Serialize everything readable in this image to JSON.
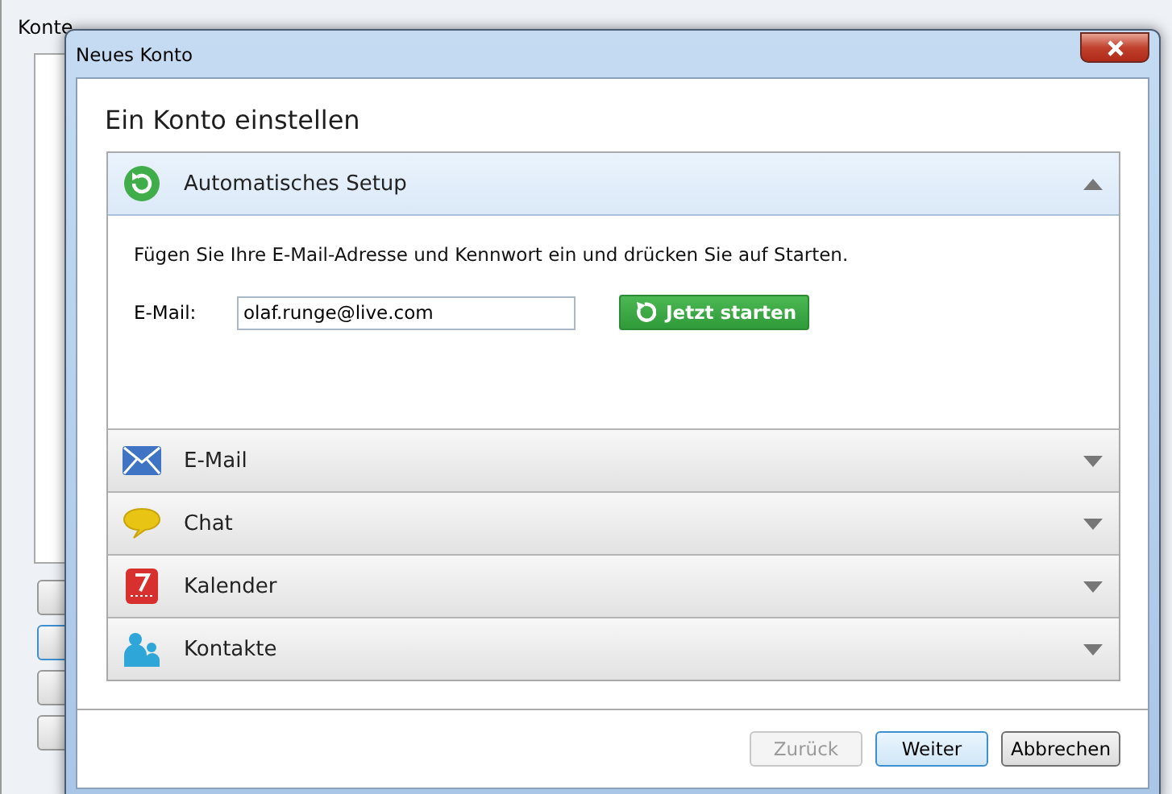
{
  "background_window": {
    "title": "Konte"
  },
  "dialog": {
    "title": "Neues Konto",
    "heading": "Ein Konto einstellen",
    "sections": [
      {
        "kind": "auto",
        "label": "Automatisches Setup",
        "expanded": true,
        "instruction": "Fügen Sie Ihre E-Mail-Adresse und Kennwort ein und drücken Sie auf Starten.",
        "field_label": "E-Mail:",
        "field_value": "olaf.runge@live.com",
        "action": "Jetzt starten"
      },
      {
        "kind": "email",
        "label": "E-Mail",
        "expanded": false
      },
      {
        "kind": "chat",
        "label": "Chat",
        "expanded": false
      },
      {
        "kind": "calendar",
        "label": "Kalender",
        "expanded": false
      },
      {
        "kind": "contacts",
        "label": "Kontakte",
        "expanded": false
      }
    ],
    "buttons": [
      {
        "label": "Zurück",
        "disabled": true,
        "default": false
      },
      {
        "label": "Weiter",
        "disabled": false,
        "default": true
      },
      {
        "label": "Abbrechen",
        "disabled": false,
        "default": false
      }
    ]
  }
}
